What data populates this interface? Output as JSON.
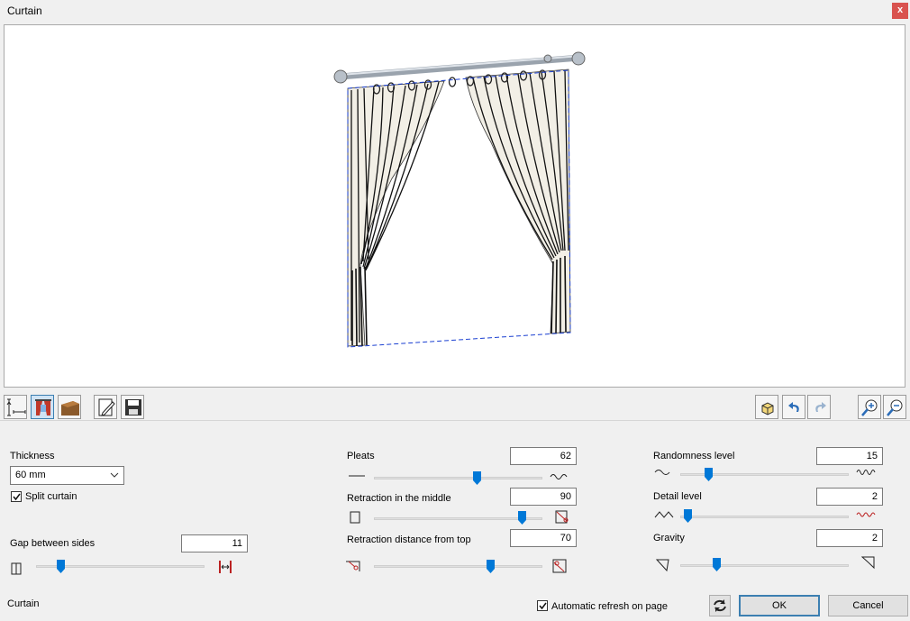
{
  "window": {
    "title": "Curtain",
    "close_label": "x"
  },
  "toolbar": {
    "left_icons": [
      "dimensions-icon",
      "curtain-icon",
      "material-icon",
      "edit-icon",
      "save-icon"
    ],
    "right_icons": [
      "3d-view-icon",
      "undo-icon",
      "redo-icon",
      "zoom-in-icon",
      "zoom-out-icon"
    ]
  },
  "left_panel": {
    "thickness_label": "Thickness",
    "thickness_value": "60 mm",
    "split_curtain_label": "Split curtain",
    "split_curtain_checked": true,
    "gap_label": "Gap between sides",
    "gap_value": "11",
    "gap_slider": 0.13
  },
  "middle_panel": {
    "pleats_label": "Pleats",
    "pleats_value": "62",
    "pleats_slider": 0.62,
    "retraction_middle_label": "Retraction in the middle",
    "retraction_middle_value": "90",
    "retraction_middle_slider": 0.9,
    "retraction_top_label": "Retraction distance from top",
    "retraction_top_value": "70",
    "retraction_top_slider": 0.7
  },
  "right_panel": {
    "randomness_label": "Randomness level",
    "randomness_value": "15",
    "randomness_slider": 0.15,
    "detail_label": "Detail level",
    "detail_value": "2",
    "detail_slider": 0.02,
    "gravity_label": "Gravity",
    "gravity_value": "2",
    "gravity_slider": 0.2
  },
  "footer": {
    "status_text": "Curtain",
    "auto_refresh_label": "Automatic refresh on page",
    "auto_refresh_checked": true,
    "ok_label": "OK",
    "cancel_label": "Cancel"
  },
  "colors": {
    "accent": "#0078d7",
    "close": "#d9534f",
    "fabric": "#f2efe6"
  }
}
